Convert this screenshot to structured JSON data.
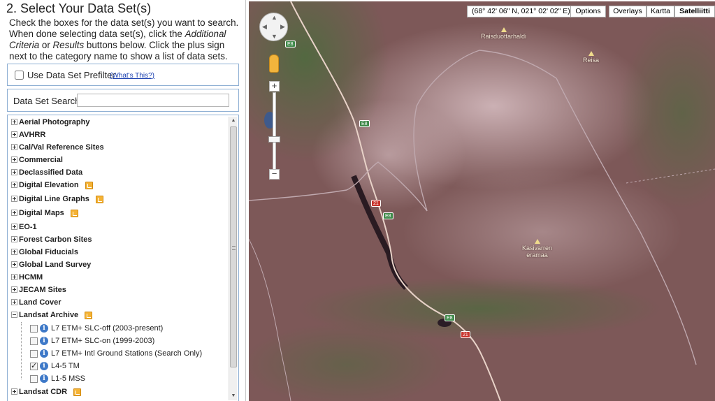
{
  "panel": {
    "title": "2. Select Your Data Set(s)",
    "instructions": {
      "part1": "Check the boxes for the data set(s) you want to search. When done selecting data set(s), click the ",
      "additional": "Additional Criteria",
      "part2": " or ",
      "results": "Results",
      "part3": " buttons below. Click the plus sign next to the category name to show a list of data sets."
    },
    "prefilter": {
      "label": "Use Data Set Prefilter",
      "link": "(What's This?)",
      "checked": false
    },
    "search": {
      "label": "Data Set Search:",
      "value": "",
      "placeholder": ""
    },
    "categories": [
      {
        "label": "Aerial Photography",
        "badge": false,
        "expanded": false
      },
      {
        "label": "AVHRR",
        "badge": false,
        "expanded": false
      },
      {
        "label": "Cal/Val Reference Sites",
        "badge": false,
        "expanded": false
      },
      {
        "label": "Commercial",
        "badge": false,
        "expanded": false
      },
      {
        "label": "Declassified Data",
        "badge": false,
        "expanded": false
      },
      {
        "label": "Digital Elevation",
        "badge": true,
        "expanded": false
      },
      {
        "label": "Digital Line Graphs",
        "badge": true,
        "expanded": false
      },
      {
        "label": "Digital Maps",
        "badge": true,
        "expanded": false
      },
      {
        "label": "EO-1",
        "badge": false,
        "expanded": false
      },
      {
        "label": "Forest Carbon Sites",
        "badge": false,
        "expanded": false
      },
      {
        "label": "Global Fiducials",
        "badge": false,
        "expanded": false
      },
      {
        "label": "Global Land Survey",
        "badge": false,
        "expanded": false
      },
      {
        "label": "HCMM",
        "badge": false,
        "expanded": false
      },
      {
        "label": "JECAM Sites",
        "badge": false,
        "expanded": false
      },
      {
        "label": "Land Cover",
        "badge": false,
        "expanded": false
      },
      {
        "label": "Landsat Archive",
        "badge": true,
        "expanded": true
      },
      {
        "label": "Landsat CDR",
        "badge": true,
        "expanded": false
      }
    ],
    "landsat_datasets": [
      {
        "label": "L7 ETM+ SLC-off (2003-present)",
        "checked": false
      },
      {
        "label": "L7 ETM+ SLC-on (1999-2003)",
        "checked": false
      },
      {
        "label": "L7 ETM+ Intl Ground Stations (Search Only)",
        "checked": false
      },
      {
        "label": "L4-5 TM",
        "checked": true
      },
      {
        "label": "L1-5 MSS",
        "checked": false
      }
    ]
  },
  "map": {
    "coordinates": "(68° 42' 06\" N, 021° 02' 02\" E)",
    "buttons": {
      "options": "Options",
      "overlays": "Overlays",
      "kartta": "Kartta",
      "satelliitti": "Satelliitti"
    },
    "selected_type": "Satelliitti",
    "places": [
      {
        "name": "Raisduottarhaldi"
      },
      {
        "name": "Reisa"
      },
      {
        "name": "Kasivarren\neramaa"
      }
    ],
    "road_labels": [
      "E8",
      "21"
    ]
  }
}
